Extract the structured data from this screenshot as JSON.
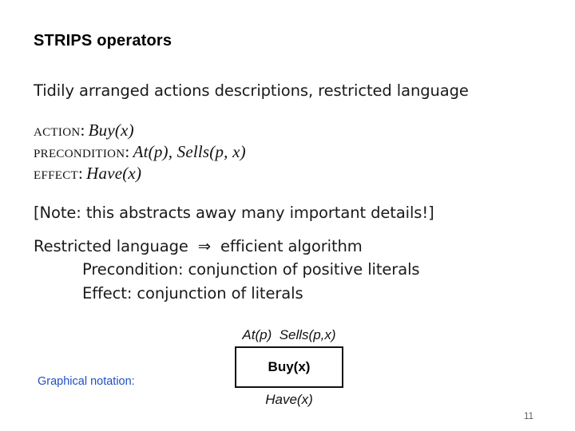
{
  "slide": {
    "title": "STRIPS operators",
    "page_number": "11",
    "accent_color": "#1f4fc4",
    "intro_line": "Tidily arranged actions descriptions, restricted language",
    "note_line": "[Note: this abstracts away many important details!]",
    "operator_schema": {
      "action_label": "Action:",
      "action_value": "Buy(x)",
      "precondition_label": "Precondition:",
      "precondition_value": "At(p), Sells(p, x)",
      "effect_label": "Effect:",
      "effect_value": "Have(x)"
    },
    "restricted": {
      "left": "Restricted language",
      "arrow": "⇒",
      "right": "efficient algorithm",
      "sub_precondition": "Precondition: conjunction of positive literals",
      "sub_effect": "Effect: conjunction of literals"
    },
    "graphical_notation": {
      "label": "Graphical notation:",
      "preconditions": "At(p)  Sells(p,x)",
      "action_box": "Buy(x)",
      "effects": "Have(x)"
    }
  }
}
